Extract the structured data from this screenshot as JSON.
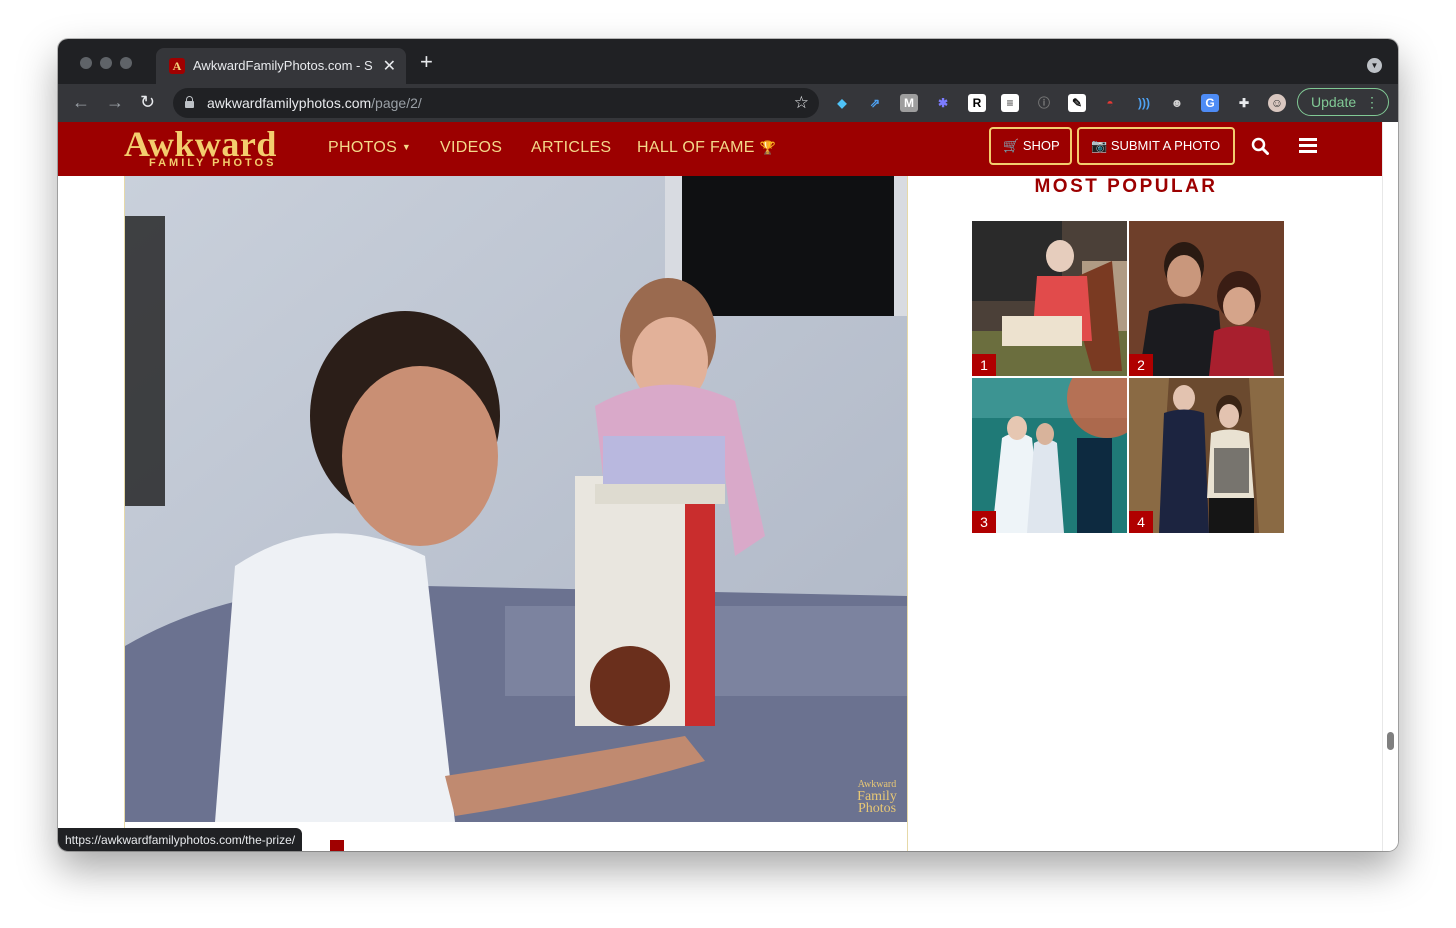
{
  "browser": {
    "tab_title": "AwkwardFamilyPhotos.com - S",
    "tab_close": "✕",
    "new_tab": "+",
    "url_host": "awkwardfamilyphotos.com",
    "url_path": "/page/2/",
    "update_label": "Update",
    "status_url": "https://awkwardfamilyphotos.com/the-prize/",
    "extensions": [
      "pin-icon",
      "share-icon",
      "m-icon",
      "snowflake-icon",
      "r-icon",
      "notes-icon",
      "info-icon",
      "edit-icon",
      "pokeball-icon",
      "audio-icon",
      "monkey-icon",
      "translate-icon",
      "puzzle-icon",
      "profile-avatar"
    ]
  },
  "site": {
    "logo_main": "Awkward",
    "logo_sub": "FAMILY PHOTOS",
    "nav": [
      {
        "label": "PHOTOS",
        "has_dropdown": true
      },
      {
        "label": "VIDEOS"
      },
      {
        "label": "ARTICLES"
      },
      {
        "label": "HALL OF FAME",
        "icon": "trophy-icon"
      }
    ],
    "shop_label": "SHOP",
    "submit_label": "SUBMIT A PHOTO",
    "brand_color": "#9c0000",
    "accent_color": "#f3cd6e"
  },
  "main_photo": {
    "watermark_top": "Awkward",
    "watermark_bottom": "Family Photos"
  },
  "sidebar": {
    "title": "MOST POPULAR",
    "thumbs": [
      {
        "rank": "1"
      },
      {
        "rank": "2"
      },
      {
        "rank": "3"
      },
      {
        "rank": "4"
      }
    ]
  }
}
